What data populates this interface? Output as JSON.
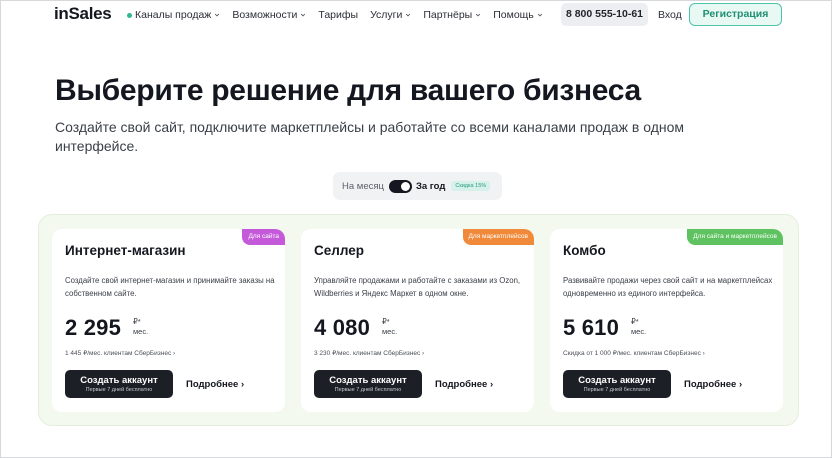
{
  "nav": {
    "logo": "inSales",
    "menu": [
      {
        "label": "Каналы продаж",
        "bullet": true
      },
      {
        "label": "Возможности"
      },
      {
        "label": "Тарифы",
        "no_chevron": true
      },
      {
        "label": "Услуги"
      },
      {
        "label": "Партнёры"
      },
      {
        "label": "Помощь"
      }
    ],
    "phone": "8 800 555-10-61",
    "login": "Вход",
    "register": "Регистрация"
  },
  "hero": {
    "title": "Выберите решение для вашего бизнеса",
    "subtitle": "Создайте свой сайт, подключите маркетплейсы и работайте со всеми каналами продаж в одном интерфейсе."
  },
  "billing": {
    "monthly": "На месяц",
    "yearly": "За год",
    "discount": "Скидка 15%",
    "selected": "yearly"
  },
  "plans": [
    {
      "badge": "Для сайта",
      "badge_color": "#c45ad9",
      "name": "Интернет-магазин",
      "desc": "Создайте свой интернет-магазин и принимайте заказы на собственном сайте.",
      "price": "2 295",
      "currency": "₽*",
      "period": "мес.",
      "sber": "1 445 ₽/мес. клиентам СберБизнес ›",
      "cta": "Создать аккаунт",
      "cta_sub": "Первые 7 дней бесплатно",
      "more": "Подробнее ›"
    },
    {
      "badge": "Для маркетплейсов",
      "badge_color": "#f08a3a",
      "name": "Селлер",
      "desc": "Управляйте продажами и работайте с заказами из Ozon, Wildberries и Яндекс Маркет в одном окне.",
      "price": "4 080",
      "currency": "₽*",
      "period": "мес.",
      "sber": "3 230 ₽/мес. клиентам СберБизнес ›",
      "cta": "Создать аккаунт",
      "cta_sub": "Первые 7 дней бесплатно",
      "more": "Подробнее ›"
    },
    {
      "badge": "Для сайта и маркетплейсов",
      "badge_color": "#5dc25f",
      "name": "Комбо",
      "desc": "Развивайте продажи через свой сайт и на маркетплейсах одновременно из единого интерфейса.",
      "price": "5 610",
      "currency": "₽*",
      "period": "мес.",
      "sber": "Скидка от 1 000 ₽/мес. клиентам СберБизнес ›",
      "cta": "Создать аккаунт",
      "cta_sub": "Первые 7 дней бесплатно",
      "more": "Подробнее ›"
    }
  ]
}
